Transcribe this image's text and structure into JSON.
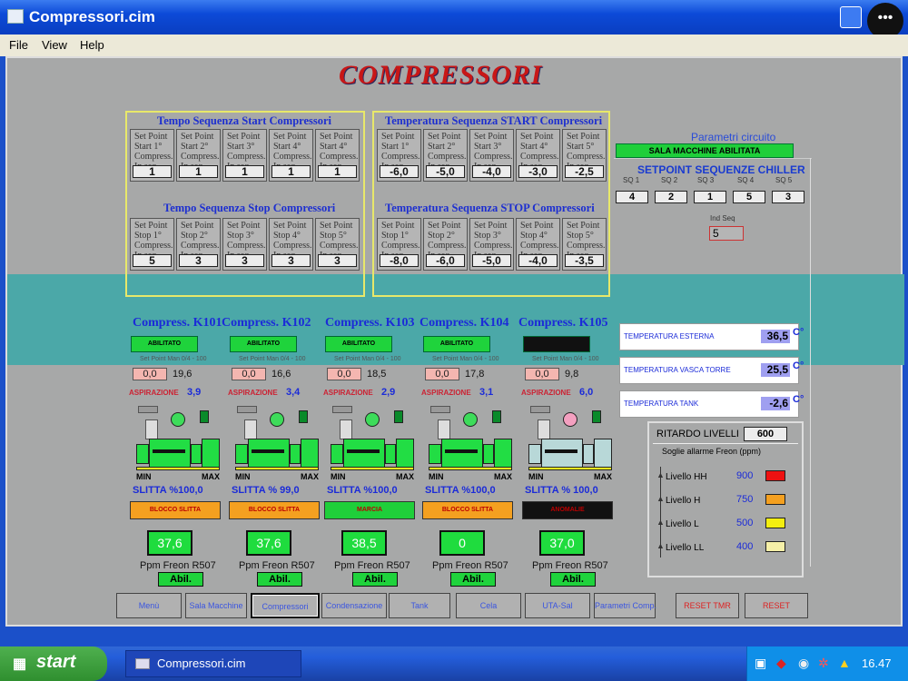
{
  "window": {
    "title": "Compressori.cim"
  },
  "menu": [
    "File",
    "View",
    "Help"
  ],
  "page_title": "COMPRESSORI",
  "start_time": {
    "title": "Tempo Sequenza Start Compressori",
    "cells": [
      {
        "label": "Set Point Start 1° Compress. In seq.",
        "value": "1"
      },
      {
        "label": "Set Point Start 2° Compress. In seq.",
        "value": "1"
      },
      {
        "label": "Set Point Start 3° Compress. In seq.",
        "value": "1"
      },
      {
        "label": "Set Point Start 4° Compress. In seq.",
        "value": "1"
      },
      {
        "label": "Set Point Start 4° Compress. In seq.",
        "value": "1"
      }
    ]
  },
  "stop_time": {
    "title": "Tempo Sequenza Stop Compressori",
    "cells": [
      {
        "label": "Set Point Stop 1° Compress. In seq.",
        "value": "5"
      },
      {
        "label": "Set Point Stop 2° Compress. In seq.",
        "value": "3"
      },
      {
        "label": "Set Point Stop 3° Compress. In seq.",
        "value": "3"
      },
      {
        "label": "Set Point Stop 4° Compress. In seq.",
        "value": "3"
      },
      {
        "label": "Set Point Stop 5° Compress. In seq.",
        "value": "3"
      }
    ]
  },
  "start_temp": {
    "title": "Temperatura Sequenza START Compressori",
    "cells": [
      {
        "label": "Set Point Start 1° Compress. In seq.",
        "value": "-6,0"
      },
      {
        "label": "Set Point Start 2° Compress. In seq.",
        "value": "-5,0"
      },
      {
        "label": "Set Point Start 3° Compress. In seq.",
        "value": "-4,0"
      },
      {
        "label": "Set Point Start 4° Compress. In seq.",
        "value": "-3,0"
      },
      {
        "label": "Set Point Start 5° Compress. In seq.",
        "value": "-2,5"
      }
    ]
  },
  "stop_temp": {
    "title": "Temperatura Sequenza STOP Compressori",
    "cells": [
      {
        "label": "Set Point Stop 1° Compress. In seq.",
        "value": "-8,0"
      },
      {
        "label": "Set Point Stop 2° Compress. In seq.",
        "value": "-6,0"
      },
      {
        "label": "Set Point Stop 3° Compress. In seq.",
        "value": "-5,0"
      },
      {
        "label": "Set Point Stop 4° Compress. In seq.",
        "value": "-4,0"
      },
      {
        "label": "Set Point Stop 5° Compress. In seq.",
        "value": "-3,5"
      }
    ]
  },
  "circuit": {
    "title": "Parametri circuito",
    "sala_button": "SALA MACCHINE ABILITATA",
    "setpoint_title": "SETPOINT SEQUENZE CHILLER",
    "sq_labels": [
      "SQ 1",
      "SQ 2",
      "SQ 3",
      "SQ 4",
      "SQ 5"
    ],
    "sq_values": [
      "4",
      "2",
      "1",
      "5",
      "3"
    ],
    "ind_label": "Ind Seq",
    "ind_value": "5"
  },
  "compressors": [
    {
      "title": "Compress. K101",
      "status": "ABILITATO",
      "setp_label": "Set Point Man 0/4 - 100",
      "setp": "0,0",
      "pval": "19,6",
      "asp_label": "ASPIRAZIONE",
      "asp": "3,9",
      "slitta": "SLITTA %100,0",
      "block": "BLOCCO SLITTA",
      "ppm": "37,6",
      "ppm_label": "Ppm Freon R507",
      "abil": "Abil.",
      "color": "#22dd44"
    },
    {
      "title": "Compress. K102",
      "status": "ABILITATO",
      "setp_label": "Set Point Man 0/4 - 100",
      "setp": "0,0",
      "pval": "16,6",
      "asp_label": "ASPIRAZIONE",
      "asp": "3,4",
      "slitta": "SLITTA % 99,0",
      "block": "BLOCCO SLITTA",
      "ppm": "37,6",
      "ppm_label": "Ppm Freon R507",
      "abil": "Abil.",
      "color": "#22dd44"
    },
    {
      "title": "Compress. K103",
      "status": "ABILITATO",
      "setp_label": "Set Point Man 0/4 - 100",
      "setp": "0,0",
      "pval": "18,5",
      "asp_label": "ASPIRAZIONE",
      "asp": "2,9",
      "slitta": "SLITTA %100,0",
      "block": "MARCIA",
      "ppm": "38,5",
      "ppm_label": "Ppm Freon R507",
      "abil": "Abil.",
      "color": "#22dd44"
    },
    {
      "title": "Compress. K104",
      "status": "ABILITATO",
      "setp_label": "Set Point Man 0/4 - 100",
      "setp": "0,0",
      "pval": "17,8",
      "asp_label": "ASPIRAZIONE",
      "asp": "3,1",
      "slitta": "SLITTA %100,0",
      "block": "BLOCCO SLITTA",
      "ppm": "0",
      "ppm_label": "Ppm Freon R507",
      "abil": "Abil.",
      "color": "#22dd44"
    },
    {
      "title": "Compress. K105",
      "status": "",
      "setp_label": "Set Point Man 0/4 - 100",
      "setp": "0,0",
      "pval": "9,8",
      "asp_label": "ASPIRAZIONE",
      "asp": "6,0",
      "slitta": "SLITTA % 100,0",
      "block": "ANOMALIE",
      "ppm": "37,0",
      "ppm_label": "Ppm Freon R507",
      "abil": "Abil.",
      "color": "#b8d8d8"
    }
  ],
  "temps": [
    {
      "label": "TEMPERATURA ESTERNA",
      "value": "36,5",
      "unit": "C°"
    },
    {
      "label": "TEMPERATURA VASCA TORRE",
      "value": "25,5",
      "unit": "C°"
    },
    {
      "label": "TEMPERATURA TANK",
      "value": "-2,6",
      "unit": "C°"
    }
  ],
  "ritardo": {
    "label": "RITARDO LIVELLI",
    "value": "600",
    "soglie": "Soglie allarme Freon (ppm)",
    "levels": [
      {
        "name": "Livello HH",
        "value": "900",
        "color": "#ee1111"
      },
      {
        "name": "Livello H",
        "value": "750",
        "color": "#f4a020"
      },
      {
        "name": "Livello L",
        "value": "500",
        "color": "#f4ee10"
      },
      {
        "name": "Livello LL",
        "value": "400",
        "color": "#f6f0a8"
      }
    ]
  },
  "nav": [
    "Menù",
    "Sala Macchine",
    "Compressori",
    "Condensazione",
    "Tank",
    "Cela",
    "UTA-Sal",
    "Parametri Comp.",
    "RESET TMR",
    "RESET"
  ],
  "taskbar": {
    "start": "start",
    "task": "Compressori.cim",
    "clock": "16.47"
  }
}
